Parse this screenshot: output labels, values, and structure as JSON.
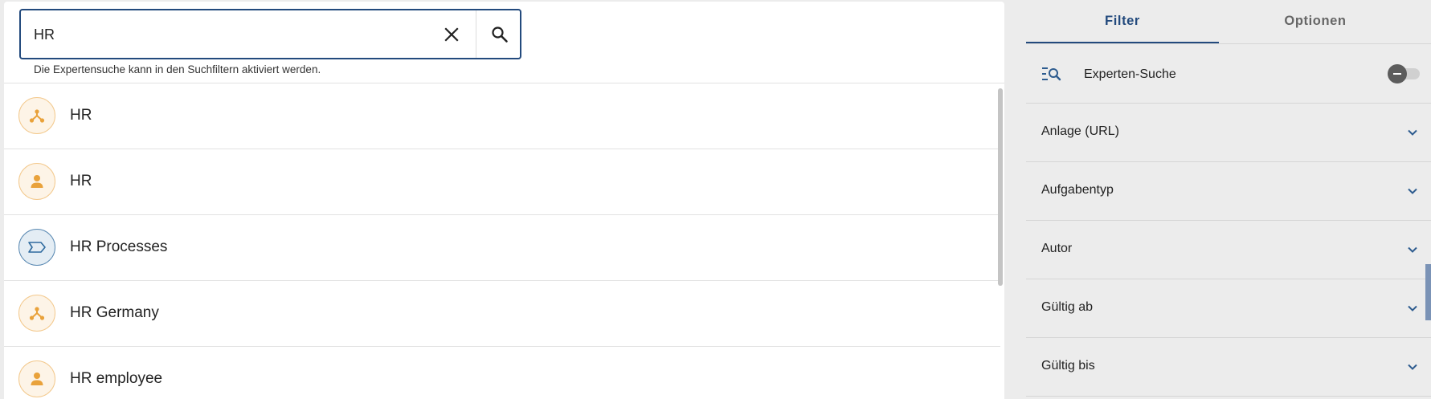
{
  "search": {
    "value": "HR",
    "hint": "Die Expertensuche kann in den Suchfiltern aktiviert werden.",
    "clear_icon": "close-icon",
    "search_icon": "search-icon"
  },
  "results": [
    {
      "label": "HR",
      "icon": "org-unit-icon",
      "style": "orange"
    },
    {
      "label": "HR",
      "icon": "person-icon",
      "style": "orange"
    },
    {
      "label": "HR Processes",
      "icon": "process-icon",
      "style": "blue"
    },
    {
      "label": "HR Germany",
      "icon": "org-unit-icon",
      "style": "orange"
    },
    {
      "label": "HR employee",
      "icon": "person-icon",
      "style": "orange"
    }
  ],
  "tabs": [
    {
      "label": "Filter",
      "active": true
    },
    {
      "label": "Optionen",
      "active": false
    }
  ],
  "expert_search": {
    "label": "Experten-Suche",
    "enabled": false,
    "icon": "expert-search-icon"
  },
  "filters": [
    {
      "label": "Anlage (URL)"
    },
    {
      "label": "Aufgabentyp"
    },
    {
      "label": "Autor"
    },
    {
      "label": "Gültig ab"
    },
    {
      "label": "Gültig bis"
    }
  ],
  "colors": {
    "accent": "#234a7d",
    "orange_icon": "#e9a23b",
    "blue_icon": "#2e6a9e"
  }
}
